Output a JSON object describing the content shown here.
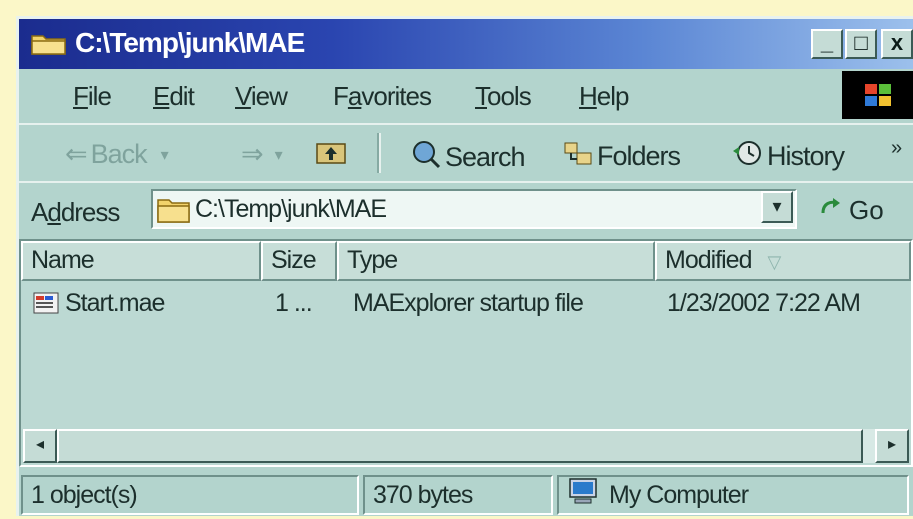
{
  "window": {
    "title": "C:\\Temp\\junk\\MAE",
    "controls": {
      "minimize": "_",
      "maximize": "□",
      "close": "x"
    }
  },
  "menu": {
    "items": [
      {
        "accel": "F",
        "rest": "ile"
      },
      {
        "accel": "E",
        "rest": "dit"
      },
      {
        "accel": "V",
        "rest": "iew"
      },
      {
        "pre": "F",
        "accel": "a",
        "rest": "vorites"
      },
      {
        "accel": "T",
        "rest": "ools"
      },
      {
        "accel": "H",
        "rest": "elp"
      }
    ]
  },
  "toolbar": {
    "back_label": "Back",
    "search_label": "Search",
    "folders_label": "Folders",
    "history_label": "History",
    "more": "»"
  },
  "address": {
    "label_pre": "A",
    "label_accel": "d",
    "label_rest": "dress",
    "value": "C:\\Temp\\junk\\MAE",
    "go_label": "Go"
  },
  "columns": {
    "name": "Name",
    "size": "Size",
    "type": "Type",
    "modified": "Modified"
  },
  "files": [
    {
      "name": "Start.mae",
      "size": "1 ...",
      "type": "MAExplorer startup file",
      "modified": "1/23/2002 7:22 AM",
      "icon": "mae-file-icon"
    }
  ],
  "status": {
    "objects": "1 object(s)",
    "bytes": "370 bytes",
    "location": "My Computer"
  },
  "colors": {
    "title_gradient_start": "#1b2c8e",
    "title_gradient_end": "#9cc0ec",
    "window_bg": "#b3d4cd",
    "outer_bg": "#fbf7c8"
  }
}
